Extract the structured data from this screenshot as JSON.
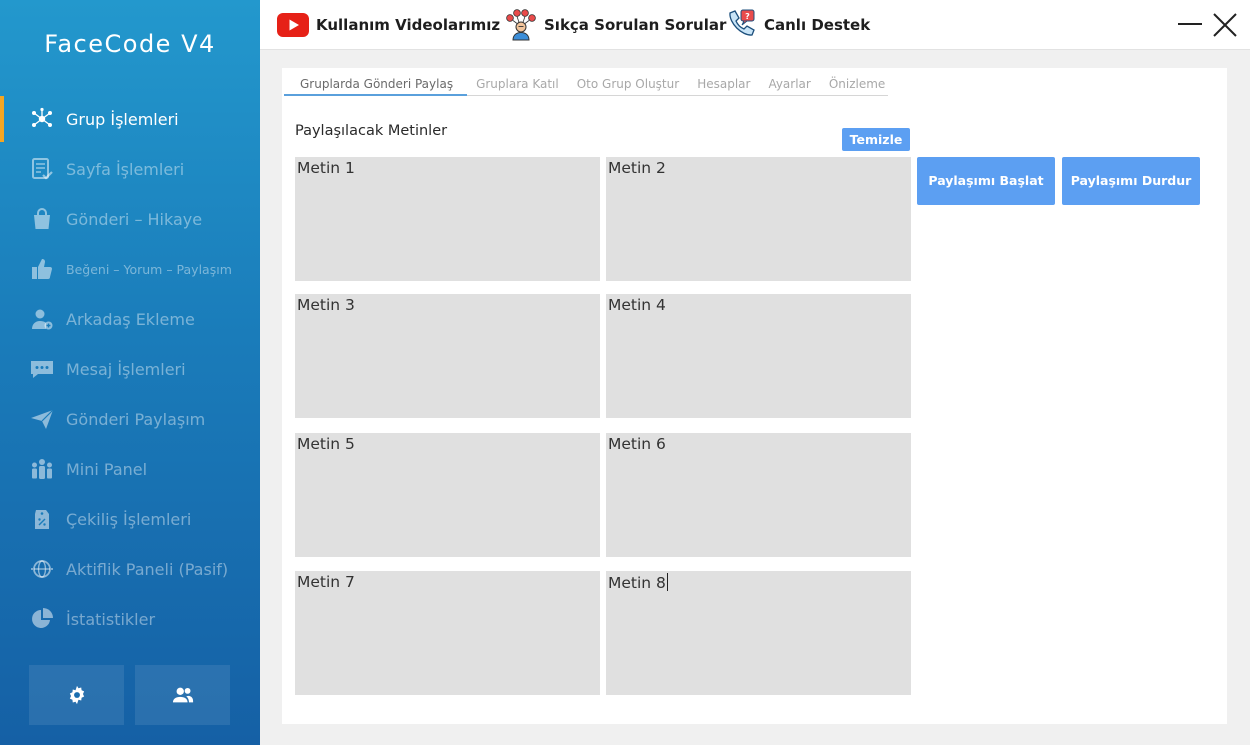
{
  "app": {
    "title": "FaceCode V4"
  },
  "sidebar": {
    "items": [
      {
        "label": "Grup İşlemleri",
        "icon": "network-icon",
        "active": true
      },
      {
        "label": "Sayfa İşlemleri",
        "icon": "page-check-icon"
      },
      {
        "label": "Gönderi – Hikaye",
        "icon": "shopping-bag-icon"
      },
      {
        "label": "Beğeni – Yorum – Paylaşım",
        "icon": "thumbs-up-icon"
      },
      {
        "label": "Arkadaş Ekleme",
        "icon": "add-user-icon"
      },
      {
        "label": "Mesaj İşlemleri",
        "icon": "chat-icon"
      },
      {
        "label": "Gönderi Paylaşım",
        "icon": "send-icon"
      },
      {
        "label": "Mini Panel",
        "icon": "people-group-icon"
      },
      {
        "label": "Çekiliş İşlemleri",
        "icon": "discount-tag-icon"
      },
      {
        "label": "Aktiflik Paneli (Pasif)",
        "icon": "globe-icon"
      },
      {
        "label": "İstatistikler",
        "icon": "pie-chart-icon"
      }
    ]
  },
  "topbar": {
    "videos_label": "Kullanım Videolarımız",
    "faq_label": "Sıkça Sorulan Sorular",
    "support_label": "Canlı Destek"
  },
  "main": {
    "tabs": [
      {
        "label": "Gruplarda Gönderi Paylaş",
        "active": true
      },
      {
        "label": "Gruplara Katıl"
      },
      {
        "label": "Oto Grup Oluştur"
      },
      {
        "label": "Hesaplar"
      },
      {
        "label": "Ayarlar"
      },
      {
        "label": "Önizleme"
      }
    ],
    "section_title": "Paylaşılacak Metinler",
    "clear_label": "Temizle",
    "texts": [
      "Metin 1",
      "Metin 2",
      "Metin 3",
      "Metin 4",
      "Metin 5",
      "Metin 6",
      "Metin 7",
      "Metin 8"
    ],
    "start_label": "Paylaşımı Başlat",
    "stop_label": "Paylaşımı Durdur"
  },
  "colors": {
    "accent": "#5c9ff2",
    "active_marker": "#f5a623",
    "sidebar_top": "#2398cd",
    "sidebar_bottom": "#1560a5",
    "textbox_bg": "#e0e0e0"
  }
}
